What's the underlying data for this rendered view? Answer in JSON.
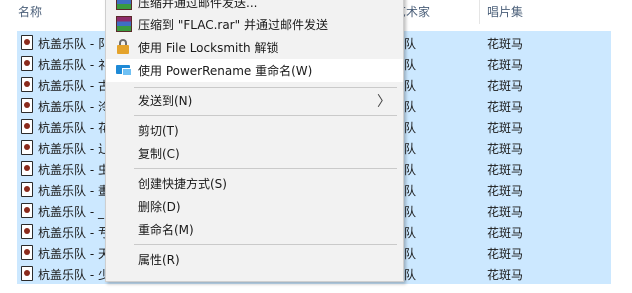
{
  "explorer": {
    "columns": {
      "name": "名称",
      "artist": "作的艺术家",
      "album": "唱片集"
    },
    "rows": [
      {
        "name": "杭盖乐队 - 阝",
        "artist": "队",
        "album": "花斑马"
      },
      {
        "name": "杭盖乐队 - 礻",
        "artist": "队",
        "album": "花斑马"
      },
      {
        "name": "杭盖乐队 - 古",
        "artist": "队",
        "album": "花斑马"
      },
      {
        "name": "杭盖乐队 - 泠",
        "artist": "队",
        "album": "花斑马"
      },
      {
        "name": "杭盖乐队 - 花",
        "artist": "队",
        "album": "花斑马"
      },
      {
        "name": "杭盖乐队 - 辶",
        "artist": "队",
        "album": "花斑马"
      },
      {
        "name": "杭盖乐队 - 虫",
        "artist": "队",
        "album": "花斑马"
      },
      {
        "name": "杭盖乐队 - 畫",
        "artist": "队",
        "album": "花斑马"
      },
      {
        "name": "杭盖乐队 - _",
        "artist": "队",
        "album": "花斑马"
      },
      {
        "name": "杭盖乐队 - 亐",
        "artist": "队",
        "album": "花斑马"
      },
      {
        "name": "杭盖乐队 - 天",
        "artist": "队",
        "album": "花斑马"
      },
      {
        "name": "杭盖乐队 - 少",
        "artist": "队",
        "album": "花斑马"
      }
    ]
  },
  "context_menu": {
    "items": [
      {
        "id": "compress-email",
        "label": "压缩并通过邮件发送...",
        "icon": "winrar-icon"
      },
      {
        "id": "compress-rar-email",
        "label": "压缩到 \"FLAC.rar\" 并通过邮件发送",
        "icon": "winrar-icon"
      },
      {
        "id": "file-locksmith",
        "label": "使用 File Locksmith 解锁",
        "icon": "lock-icon"
      },
      {
        "id": "power-rename",
        "label": "使用 PowerRename 重命名(W)",
        "icon": "powerrename-icon"
      },
      {
        "id": "send-to",
        "label": "发送到(N)",
        "icon": ""
      },
      {
        "id": "cut",
        "label": "剪切(T)",
        "icon": ""
      },
      {
        "id": "copy",
        "label": "复制(C)",
        "icon": ""
      },
      {
        "id": "create-shortcut",
        "label": "创建快捷方式(S)",
        "icon": ""
      },
      {
        "id": "delete",
        "label": "删除(D)",
        "icon": ""
      },
      {
        "id": "rename",
        "label": "重命名(M)",
        "icon": ""
      },
      {
        "id": "properties",
        "label": "属性(R)",
        "icon": ""
      }
    ],
    "submenu_arrow": "〉"
  },
  "colors": {
    "selection": "#cce8ff",
    "menu_bg": "#f2f2f2",
    "menu_hover": "#ffffff"
  }
}
